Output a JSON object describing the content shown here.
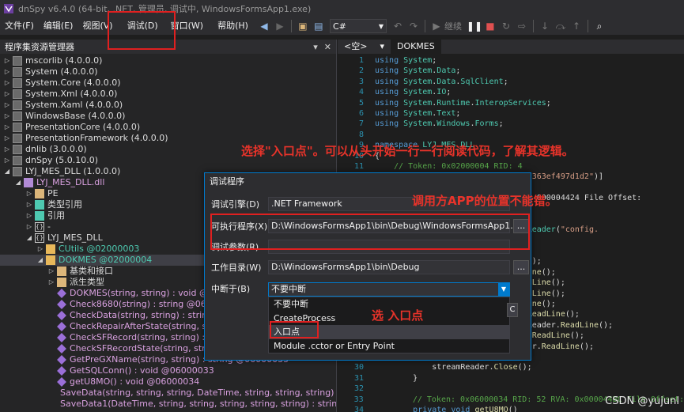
{
  "window": {
    "title": "dnSpy v6.4.0 (64-bit, .NET, 管理员, 调试中, WindowsFormsApp1.exe)"
  },
  "menu": {
    "items": [
      {
        "label": "文件(F)"
      },
      {
        "label": "编辑(E)"
      },
      {
        "label": "视图(V)"
      },
      {
        "label": "调试(D)"
      },
      {
        "label": "窗口(W)"
      },
      {
        "label": "帮助(H)"
      }
    ],
    "language": "C#",
    "continue_label": "继续"
  },
  "explorer": {
    "title": "程序集资源管理器",
    "rows": [
      {
        "text": "mscorlib (4.0.0.0)"
      },
      {
        "text": "System (4.0.0.0)"
      },
      {
        "text": "System.Core (4.0.0.0)"
      },
      {
        "text": "System.Xml (4.0.0.0)"
      },
      {
        "text": "System.Xaml (4.0.0.0)"
      },
      {
        "text": "WindowsBase (4.0.0.0)"
      },
      {
        "text": "PresentationCore (4.0.0.0)"
      },
      {
        "text": "PresentationFramework (4.0.0.0)"
      },
      {
        "text": "dnlib (3.0.0.0)"
      },
      {
        "text": "dnSpy (5.0.10.0)"
      },
      {
        "text": "LYJ_MES_DLL (1.0.0.0)"
      },
      {
        "text": "LYJ_MES_DLL.dll"
      },
      {
        "text": "PE"
      },
      {
        "text": "类型引用"
      },
      {
        "text": "引用"
      },
      {
        "text": "-"
      },
      {
        "text": "LYJ_MES_DLL"
      },
      {
        "text": "CUtils @02000003"
      },
      {
        "text": "DOKMES @02000004"
      },
      {
        "text": "基类和接口"
      },
      {
        "text": "派生类型"
      },
      {
        "text": "DOKMES(string, string) : void @0600002"
      },
      {
        "text": "Check8680(string) : string @060"
      },
      {
        "text": "CheckData(string, string) : string @060"
      },
      {
        "text": "CheckRepairAfterState(string, string) : string @060"
      },
      {
        "text": "CheckSFRecord(string, string) : string @0600003F"
      },
      {
        "text": "CheckSFRecordState(string, string) : string @0600003D"
      },
      {
        "text": "GetPreGXName(string, string) : string @06000035"
      },
      {
        "text": "GetSQLConn() : void @06000033"
      },
      {
        "text": "getU8MO() : void @06000034"
      },
      {
        "text": "SaveData(string, string, string, DateTime, string, string, string) : string"
      },
      {
        "text": "SaveData1(DateTime, string, string, string, string, string) : string"
      }
    ]
  },
  "editor": {
    "tabs": [
      {
        "label": "<空>"
      },
      {
        "label": "DOKMES"
      }
    ],
    "lines": [
      {
        "n": "1",
        "t": "using System;"
      },
      {
        "n": "2",
        "t": "using System.Data;"
      },
      {
        "n": "3",
        "t": "using System.Data.SqlClient;"
      },
      {
        "n": "4",
        "t": "using System.IO;"
      },
      {
        "n": "5",
        "t": "using System.Runtime.InteropServices;"
      },
      {
        "n": "6",
        "t": "using System.Text;"
      },
      {
        "n": "7",
        "t": "using System.Windows.Forms;"
      },
      {
        "n": "8",
        "t": ""
      },
      {
        "n": "9",
        "t": "namespace LYJ_MES_DLL"
      },
      {
        "n": "10",
        "t": "{"
      },
      {
        "n": "11",
        "t": "    // Token: 0x02000004 RID: 4"
      },
      {
        "n": "12",
        "t": "    [Guid(\"c60067-3a4a-4b06-9756-363ef497d1d2\")]"
      },
      {
        "n": "13",
        "t": ""
      },
      {
        "n": "14",
        "t": "                               A: 0x00004424 File Offset:"
      },
      {
        "n": "15",
        "t": "                               )"
      },
      {
        "n": "16",
        "t": ""
      },
      {
        "n": "17",
        "t": "              eader = new StreamReader(\"config."
      },
      {
        "n": "18",
        "t": "              k() >= 0)"
      },
      {
        "n": "19",
        "t": ""
      },
      {
        "n": "20",
        "t": "              eamReader.ReadLine();"
      },
      {
        "n": "21",
        "t": "              streamReader.ReadLine();"
      },
      {
        "n": "22",
        "t": "              = streamReader.ReadLine();"
      },
      {
        "n": "23",
        "t": "              = streamReader.ReadLine();"
      },
      {
        "n": "24",
        "t": "              streamReader.ReadLine();"
      },
      {
        "n": "25",
        "t": "              ng = streamReader.ReadLine();"
      },
      {
        "n": "26",
        "t": "              stProcess = streamReader.ReadLine();"
      },
      {
        "n": "27",
        "t": "              ime = streamReader.ReadLine();"
      },
      {
        "n": "28",
        "t": "              etime = streamReader.ReadLine();"
      },
      {
        "n": "29",
        "t": ""
      },
      {
        "n": "30",
        "t": "            streamReader.Close();"
      },
      {
        "n": "31",
        "t": "        }"
      },
      {
        "n": "32",
        "t": ""
      },
      {
        "n": "33",
        "t": "        // Token: 0x06000034 RID: 52 RVA: 0x000044BC File Offset:"
      },
      {
        "n": "34",
        "t": "        private void getU8MO()"
      },
      {
        "n": "35",
        "t": "        {"
      }
    ]
  },
  "dialog": {
    "title": "调试程序",
    "engine_label": "调试引擎(D)",
    "engine_value": ".NET Framework",
    "exe_label": "可执行程序(X)",
    "exe_value": "D:\\WindowsFormsApp1\\bin\\Debug\\WindowsFormsApp1.exe",
    "args_label": "调试参数(R)",
    "args_value": "",
    "workdir_label": "工作目录(W)",
    "workdir_value": "D:\\WindowsFormsApp1\\bin\\Debug",
    "break_label": "中断于(B)",
    "break_value": "不要中断",
    "browse_label": "...",
    "break_options": [
      {
        "label": "不要中断"
      },
      {
        "label": "CreateProcess"
      },
      {
        "label": "入口点"
      },
      {
        "label": "Module .cctor or Entry Point"
      }
    ]
  },
  "annotations": {
    "note1": "选择\"入口点\"。可以从头开始一行一行阅读代码，了解其逻辑。",
    "note2": "调用方APP的位置不能错。",
    "note3": "选 入口点"
  },
  "watermark": "CSDN @yujunl"
}
